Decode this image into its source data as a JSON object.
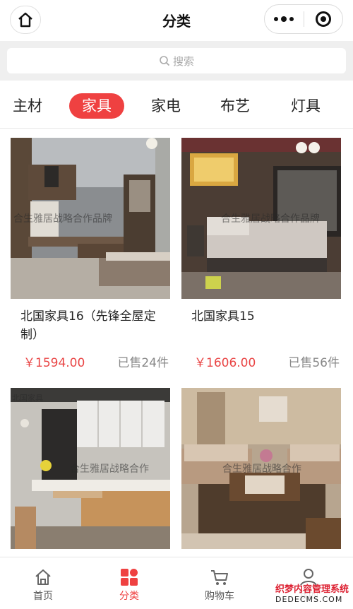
{
  "header": {
    "title": "分类",
    "home_icon": "home-icon",
    "more_icon": "more-dots-icon",
    "close_icon": "target-circle-icon"
  },
  "search": {
    "placeholder": "搜索",
    "icon": "search-icon"
  },
  "tabs": [
    {
      "label": "主材",
      "active": false
    },
    {
      "label": "家具",
      "active": true
    },
    {
      "label": "家电",
      "active": false
    },
    {
      "label": "布艺",
      "active": false
    },
    {
      "label": "灯具",
      "active": false
    }
  ],
  "products": [
    {
      "name": "北国家具16（先锋全屋定制）",
      "price": "￥1594.00",
      "sold": "已售24件",
      "watermark": "合生雅居战略合作品牌"
    },
    {
      "name": "北国家具15",
      "price": "￥1606.00",
      "sold": "已售56件",
      "watermark": "合生雅居战略合作品牌"
    },
    {
      "name": "",
      "price": "",
      "sold": "",
      "watermark": "合生雅居战略合作",
      "corner_label": "北国家具"
    },
    {
      "name": "",
      "price": "",
      "sold": "",
      "watermark": "合生雅居战略合作"
    }
  ],
  "bottom_nav": [
    {
      "label": "首页",
      "icon": "home-icon",
      "active": false
    },
    {
      "label": "分类",
      "icon": "category-grid-icon",
      "active": true
    },
    {
      "label": "购物车",
      "icon": "cart-icon",
      "active": false
    },
    {
      "label": "我的",
      "icon": "user-icon",
      "active": false
    }
  ],
  "site_mark": {
    "line1": "织梦内容管理系统",
    "line2": "DEDECMS.COM"
  },
  "colors": {
    "accent": "#ef4141",
    "price": "#e94545"
  }
}
